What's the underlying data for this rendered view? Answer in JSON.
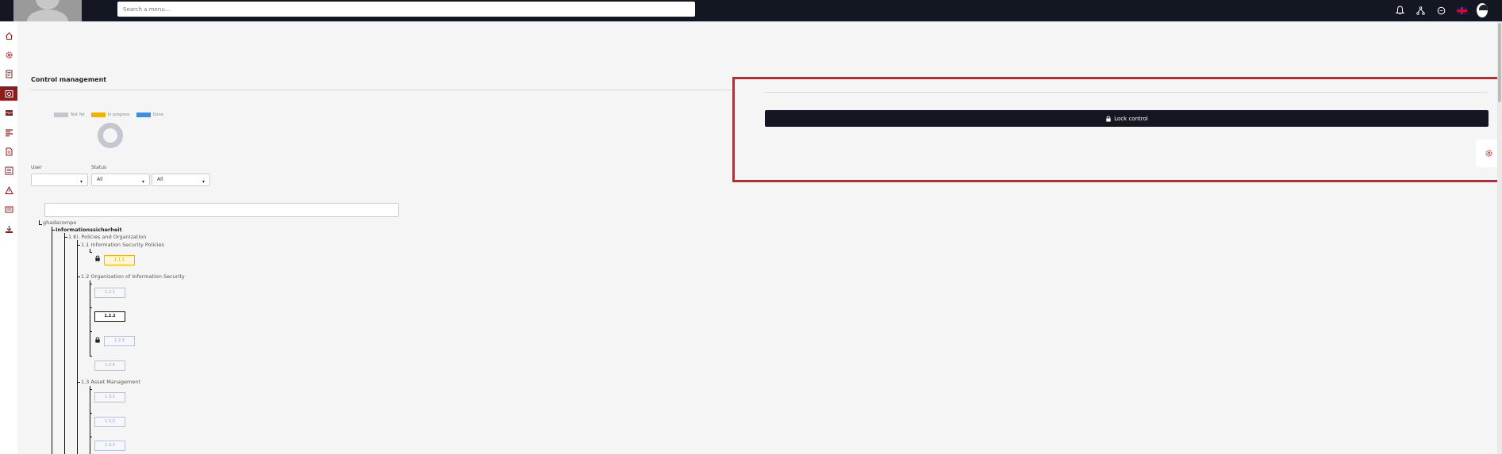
{
  "header": {
    "search_placeholder": "Search a menu...",
    "icons": [
      "bell-icon",
      "sitemap-icon",
      "chat-icon",
      "uk-flag-icon",
      "user-avatar"
    ]
  },
  "sidebar": {
    "items": [
      {
        "icon": "home-icon"
      },
      {
        "icon": "gear-icon"
      },
      {
        "icon": "document-icon"
      },
      {
        "icon": "dashboard-icon",
        "active": true
      },
      {
        "icon": "inbox-icon"
      },
      {
        "icon": "list-icon"
      },
      {
        "icon": "file-icon"
      },
      {
        "icon": "checklist-icon"
      },
      {
        "icon": "warning-icon"
      },
      {
        "icon": "book-icon"
      },
      {
        "icon": "download-icon"
      }
    ]
  },
  "page": {
    "title": "Control management"
  },
  "legend": [
    {
      "label": "Not Yet",
      "color": "#c5c7d0"
    },
    {
      "label": "In progress",
      "color": "#f2b200"
    },
    {
      "label": "Done",
      "color": "#3b8fe0"
    }
  ],
  "filters": {
    "user_label": "User",
    "user_value": "",
    "status_label": "Status",
    "status_value": "All",
    "third_value": "All"
  },
  "tree": {
    "root": "ghadacompo",
    "level1": "Informationssicherheit",
    "level2": "1 Ki. Policies and Organization",
    "sections": {
      "s11": "1.1 Information Security Policies",
      "s12": "1.2 Organization of Information Security",
      "s13": "1.3 Asset Management"
    },
    "leaves": {
      "l111": "1.1.1",
      "l121": "1.2.1",
      "l122": "1.2.2",
      "l123": "1.2.3",
      "l124": "1.2.4",
      "l131": "1.3.1",
      "l132": "1.3.2",
      "l133": "1.3.3"
    }
  },
  "panel": {
    "lock_button": "Lock control"
  },
  "colors": {
    "topbar": "#141722",
    "accent": "#8f1b1b",
    "highlight_border": "#d4202a"
  }
}
